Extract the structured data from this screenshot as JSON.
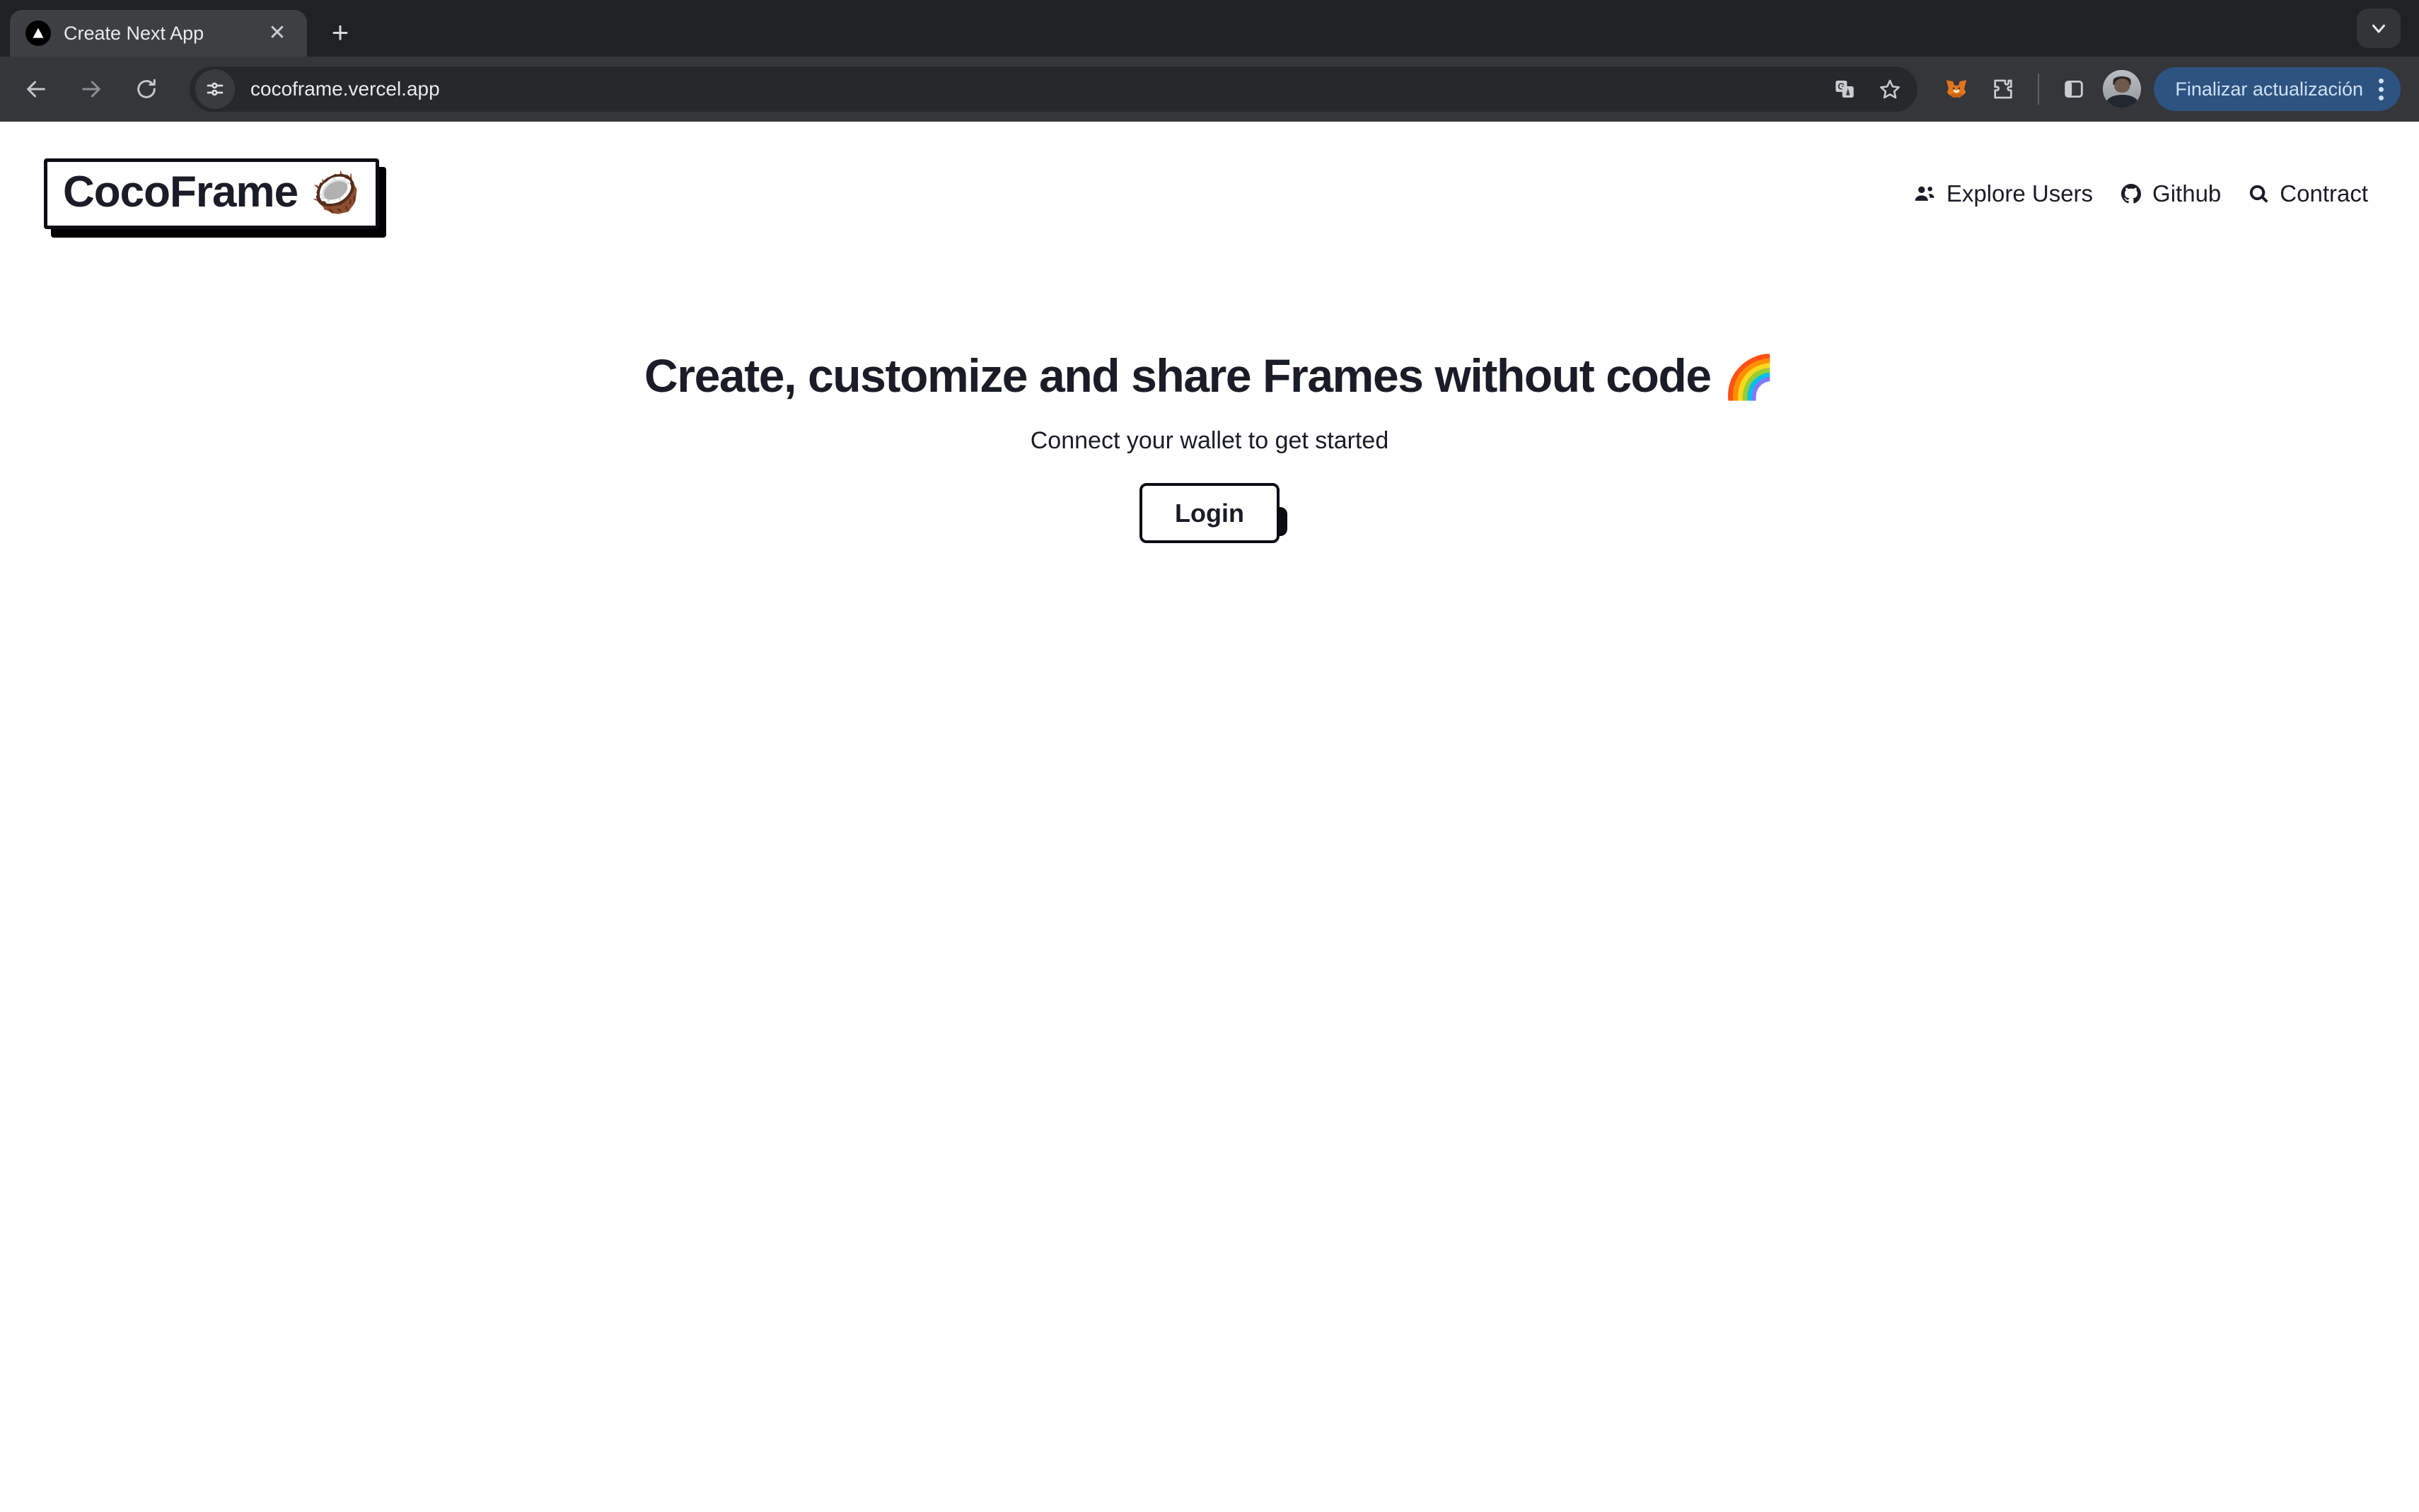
{
  "browser": {
    "tab": {
      "title": "Create Next App",
      "favicon_icon": "nextjs-triangle-icon",
      "close_icon": "close-icon"
    },
    "new_tab_icon": "plus-icon",
    "tab_search_icon": "chevron-down-icon",
    "nav": {
      "back_icon": "back-arrow-icon",
      "forward_icon": "forward-arrow-icon",
      "reload_icon": "reload-icon"
    },
    "omnibox": {
      "site_settings_icon": "tune-icon",
      "url": "cocoframe.vercel.app",
      "translate_icon": "translate-icon",
      "bookmark_icon": "star-icon"
    },
    "extensions": {
      "metamask_icon": "metamask-fox-icon",
      "puzzle_icon": "extensions-puzzle-icon",
      "side_panel_icon": "side-panel-icon",
      "avatar_icon": "profile-avatar"
    },
    "update": {
      "label": "Finalizar actualización",
      "menu_icon": "kebab-menu-icon"
    }
  },
  "site": {
    "logo": {
      "text": "CocoFrame",
      "emoji": "🥥",
      "icon": "coconut-icon"
    },
    "nav": [
      {
        "label": "Explore Users",
        "icon": "users-group-icon"
      },
      {
        "label": "Github",
        "icon": "github-icon"
      },
      {
        "label": "Contract",
        "icon": "search-icon"
      }
    ],
    "hero": {
      "headline": "Create, customize and share Frames without code",
      "headline_emoji": "🌈",
      "subtitle": "Connect your wallet to get started",
      "login_label": "Login"
    },
    "colors": {
      "ink": "#1a1d27",
      "border": "#0b0d13",
      "background": "#ffffff",
      "chrome": "#35363a",
      "update_button": "#2d5380"
    }
  }
}
